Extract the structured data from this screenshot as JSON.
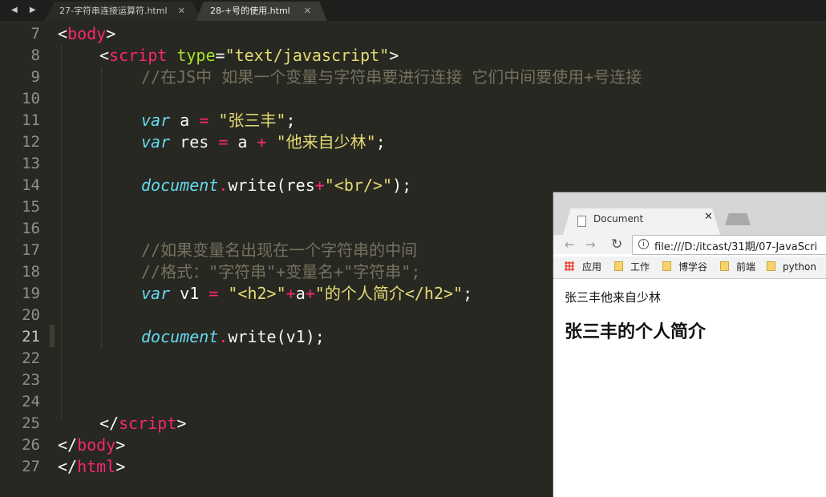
{
  "editor": {
    "nav_arrows": "◀ ▶",
    "tabs": [
      {
        "label": "27-字符串连接运算符.html",
        "close": "✕"
      },
      {
        "label": "28-+号的使用.html",
        "close": "✕"
      }
    ],
    "line_numbers": [
      "7",
      "8",
      "9",
      "10",
      "11",
      "12",
      "13",
      "14",
      "15",
      "16",
      "17",
      "18",
      "19",
      "20",
      "21",
      "22",
      "23",
      "24",
      "25",
      "26",
      "27"
    ],
    "current_line": "21",
    "code": {
      "l7": {
        "open": "<",
        "tag": "body",
        "close": ">"
      },
      "l8": {
        "open": "<",
        "tag": "script",
        "sp": " ",
        "attr": "type",
        "eq": "=",
        "val": "\"text/javascript\"",
        "close": ">"
      },
      "l9": {
        "comment": "//在JS中 如果一个变量与字符串要进行连接 它们中间要使用+号连接"
      },
      "l11": {
        "kw": "var",
        "name": " a ",
        "op": "=",
        "sp": " ",
        "str": "\"张三丰\"",
        "end": ";"
      },
      "l12": {
        "kw": "var",
        "name": " res ",
        "op": "=",
        "mid": " a ",
        "op2": "+",
        "sp": " ",
        "str": "\"他来自少林\"",
        "end": ";"
      },
      "l14": {
        "obj": "document",
        "dot": ".",
        "call": "write(res",
        "op": "+",
        "str": "\"<br/>\"",
        "end": ");"
      },
      "l17": {
        "comment": "//如果变量名出现在一个字符串的中间"
      },
      "l18": {
        "comment": "//格式：\"字符串\"+变量名+\"字符串\";"
      },
      "l19": {
        "kw": "var",
        "name": " v1 ",
        "op": "=",
        "sp": " ",
        "str1": "\"<h2>\"",
        "op2": "+",
        "mid": "a",
        "op3": "+",
        "str2": "\"的个人简介</h2>\"",
        "end": ";"
      },
      "l21": {
        "obj": "document",
        "dot": ".",
        "call": "write(v1);"
      },
      "l25": {
        "open": "</",
        "tag": "script",
        "close": ">"
      },
      "l26": {
        "open": "</",
        "tag": "body",
        "close": ">"
      },
      "l27": {
        "open": "</",
        "tag": "html",
        "close": ">"
      }
    }
  },
  "browser": {
    "tab_title": "Document",
    "tab_close": "✕",
    "back": "←",
    "forward": "→",
    "reload": "↻",
    "info_icon": "i",
    "url": "file:///D:/itcast/31期/07-JavaScri",
    "bookmarks": {
      "apps": "应用",
      "items": [
        "工作",
        "博学谷",
        "前端",
        "python"
      ]
    },
    "page": {
      "text": "张三丰他来自少林",
      "heading": "张三丰的个人简介"
    }
  }
}
